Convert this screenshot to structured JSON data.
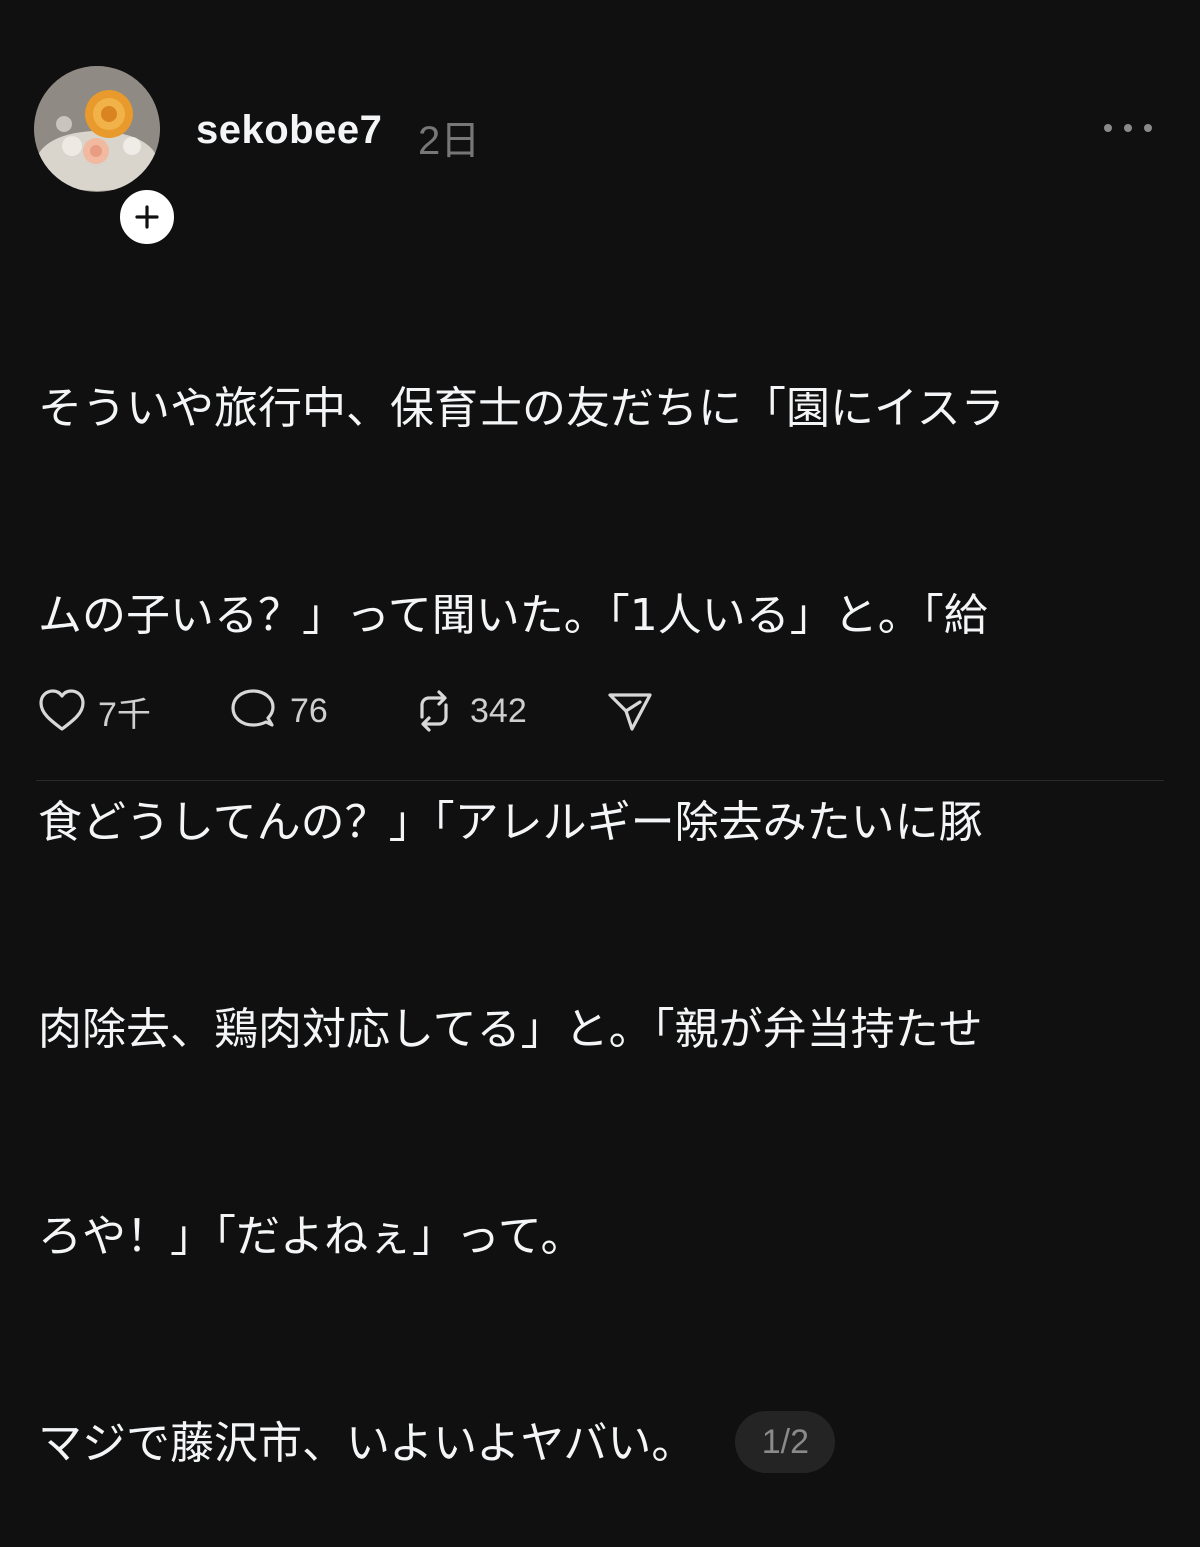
{
  "post": {
    "username": "sekobee7",
    "time": "2日",
    "text_lines": [
      "そういや旅行中、保育士の友だちに「園にイスラ",
      "ムの子いる？」って聞いた。「1人いる」と。「給",
      "食どうしてんの？」「アレルギー除去みたいに豚",
      "肉除去、鶏肉対応してる」と。「親が弁当持たせ",
      "ろや！」「だよねぇ」って。",
      "マジで藤沢市、いよいよヤバい。"
    ],
    "page_indicator": "1/2",
    "actions": {
      "likes": "7千",
      "replies": "76",
      "reposts": "342"
    }
  },
  "icons": {
    "follow": "plus-icon",
    "more": "more-horizontal-icon",
    "like": "heart-icon",
    "reply": "comment-icon",
    "repost": "repost-icon",
    "share": "send-icon"
  },
  "colors": {
    "background": "#101010",
    "text": "#f3f5f7",
    "muted": "#777777"
  }
}
